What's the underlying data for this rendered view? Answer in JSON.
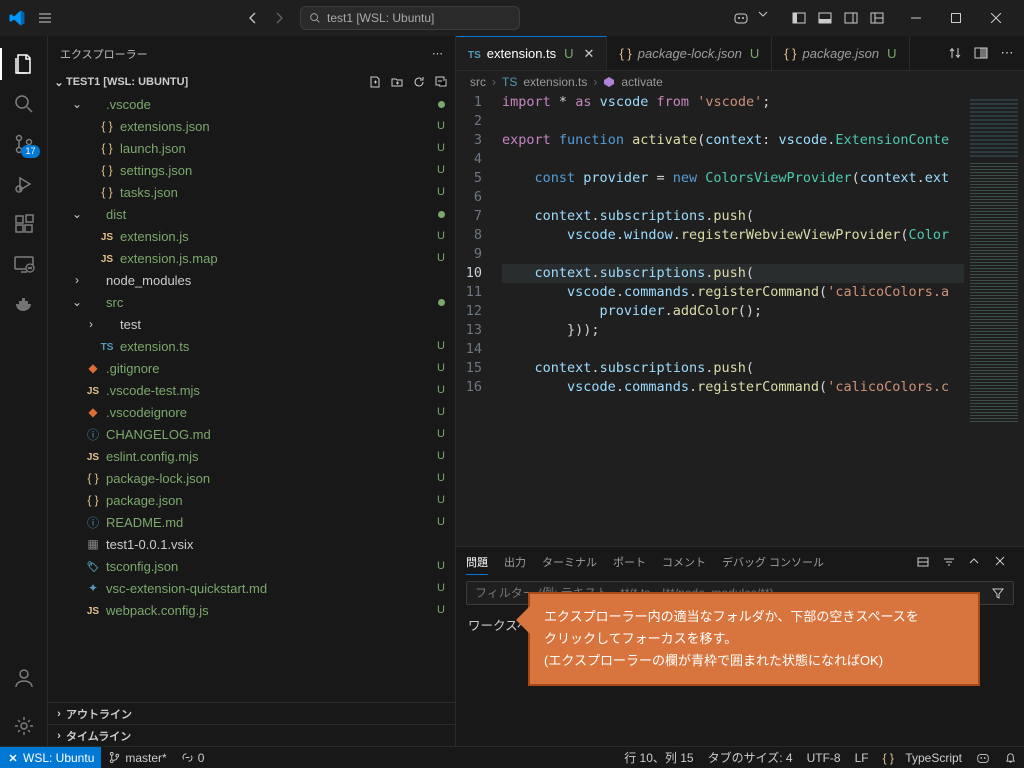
{
  "title_search": "test1 [WSL: Ubuntu]",
  "explorer": {
    "title": "エクスプローラー",
    "section": "TEST1 [WSL: UBUNTU]",
    "outline": "アウトライン",
    "timeline": "タイムライン"
  },
  "badge_scm": "17",
  "tree": [
    {
      "depth": 1,
      "kind": "folder",
      "open": true,
      "label": ".vscode",
      "decor": "dot"
    },
    {
      "depth": 2,
      "kind": "json",
      "label": "extensions.json",
      "decor": "U"
    },
    {
      "depth": 2,
      "kind": "json",
      "label": "launch.json",
      "decor": "U"
    },
    {
      "depth": 2,
      "kind": "json",
      "label": "settings.json",
      "decor": "U"
    },
    {
      "depth": 2,
      "kind": "json",
      "label": "tasks.json",
      "decor": "U"
    },
    {
      "depth": 1,
      "kind": "folder",
      "open": true,
      "label": "dist",
      "decor": "dot"
    },
    {
      "depth": 2,
      "kind": "js",
      "label": "extension.js",
      "decor": "U"
    },
    {
      "depth": 2,
      "kind": "js",
      "label": "extension.js.map",
      "decor": "U"
    },
    {
      "depth": 1,
      "kind": "folder",
      "open": false,
      "label": "node_modules",
      "decor": ""
    },
    {
      "depth": 1,
      "kind": "folder",
      "open": true,
      "label": "src",
      "decor": "dot"
    },
    {
      "depth": 2,
      "kind": "folder",
      "open": false,
      "label": "test",
      "decor": ""
    },
    {
      "depth": 2,
      "kind": "ts",
      "label": "extension.ts",
      "decor": "U"
    },
    {
      "depth": 1,
      "kind": "git",
      "label": ".gitignore",
      "decor": "U"
    },
    {
      "depth": 1,
      "kind": "js",
      "label": ".vscode-test.mjs",
      "decor": "U"
    },
    {
      "depth": 1,
      "kind": "git",
      "label": ".vscodeignore",
      "decor": "U"
    },
    {
      "depth": 1,
      "kind": "info",
      "label": "CHANGELOG.md",
      "decor": "U"
    },
    {
      "depth": 1,
      "kind": "js",
      "label": "eslint.config.mjs",
      "decor": "U"
    },
    {
      "depth": 1,
      "kind": "json",
      "label": "package-lock.json",
      "decor": "U"
    },
    {
      "depth": 1,
      "kind": "json",
      "label": "package.json",
      "decor": "U"
    },
    {
      "depth": 1,
      "kind": "info",
      "label": "README.md",
      "decor": "U"
    },
    {
      "depth": 1,
      "kind": "box",
      "label": "test1-0.0.1.vsix",
      "decor": ""
    },
    {
      "depth": 1,
      "kind": "tsc",
      "label": "tsconfig.json",
      "decor": "U"
    },
    {
      "depth": 1,
      "kind": "md",
      "label": "vsc-extension-quickstart.md",
      "decor": "U"
    },
    {
      "depth": 1,
      "kind": "js",
      "label": "webpack.config.js",
      "decor": "U"
    }
  ],
  "tabs": [
    {
      "icon": "ts",
      "label": "extension.ts",
      "mod": "U",
      "active": true,
      "italic": false,
      "close": true
    },
    {
      "icon": "json",
      "label": "package-lock.json",
      "mod": "U",
      "active": false,
      "italic": true,
      "close": false
    },
    {
      "icon": "json",
      "label": "package.json",
      "mod": "U",
      "active": false,
      "italic": true,
      "close": false
    }
  ],
  "breadcrumbs": [
    "src",
    "extension.ts",
    "activate"
  ],
  "code_lines": [
    "<span class='tok-pink'>import</span> <span class='tok-pun'>*</span> <span class='tok-pink'>as</span> <span class='tok-lblue'>vscode</span> <span class='tok-pink'>from</span> <span class='tok-str'>'vscode'</span><span class='tok-pun'>;</span>",
    "",
    "<span class='tok-pink'>export</span> <span class='tok-blue'>function</span> <span class='tok-fn'>activate</span><span class='tok-pun'>(</span><span class='tok-lblue'>context</span><span class='tok-pun'>:</span> <span class='tok-lblue'>vscode</span><span class='tok-pun'>.</span><span class='tok-type'>ExtensionConte</span>",
    "",
    "    <span class='tok-blue'>const</span> <span class='tok-lblue'>provider</span> <span class='tok-pun'>=</span> <span class='tok-blue'>new</span> <span class='tok-type'>ColorsViewProvider</span><span class='tok-pun'>(</span><span class='tok-lblue'>context</span><span class='tok-pun'>.</span><span class='tok-lblue'>ext</span>",
    "",
    "    <span class='tok-lblue'>context</span><span class='tok-pun'>.</span><span class='tok-lblue'>subscriptions</span><span class='tok-pun'>.</span><span class='tok-fn'>push</span><span class='tok-pun'>(</span>",
    "        <span class='tok-lblue'>vscode</span><span class='tok-pun'>.</span><span class='tok-lblue'>window</span><span class='tok-pun'>.</span><span class='tok-fn'>registerWebviewViewProvider</span><span class='tok-pun'>(</span><span class='tok-type'>Color</span>",
    "",
    "    <span class='tok-lblue'>context</span><span class='tok-pun'>.</span><span class='tok-lblue'>subscriptions</span><span class='tok-pun'>.</span><span class='tok-fn'>push</span><span class='tok-pun'>(</span>",
    "        <span class='tok-lblue'>vscode</span><span class='tok-pun'>.</span><span class='tok-lblue'>commands</span><span class='tok-pun'>.</span><span class='tok-fn'>registerCommand</span><span class='tok-pun'>(</span><span class='tok-str'>'calicoColors.a</span>",
    "            <span class='tok-lblue'>provider</span><span class='tok-pun'>.</span><span class='tok-fn'>addColor</span><span class='tok-pun'>();</span>",
    "        <span class='tok-pun'>}));</span>",
    "",
    "    <span class='tok-lblue'>context</span><span class='tok-pun'>.</span><span class='tok-lblue'>subscriptions</span><span class='tok-pun'>.</span><span class='tok-fn'>push</span><span class='tok-pun'>(</span>",
    "        <span class='tok-lblue'>vscode</span><span class='tok-pun'>.</span><span class='tok-lblue'>commands</span><span class='tok-pun'>.</span><span class='tok-fn'>registerCommand</span><span class='tok-pun'>(</span><span class='tok-str'>'calicoColors.c</span>"
  ],
  "current_line": 10,
  "panel": {
    "tabs": [
      "問題",
      "出力",
      "ターミナル",
      "ポート",
      "コメント",
      "デバッグ コンソール"
    ],
    "active": 0,
    "filter_ph": "フィルター (例: テキスト、**/*.ts、!**/node_modules/**)",
    "msg": "ワークスペースで問題は検出されていません。"
  },
  "status": {
    "remote": "WSL: Ubuntu",
    "branch": "master*",
    "ports": "0",
    "cursor": "行 10、列 15",
    "tabsize": "タブのサイズ: 4",
    "encoding": "UTF-8",
    "eol": "LF",
    "lang": "TypeScript"
  },
  "callout": {
    "l1": "エクスプローラー内の適当なフォルダか、下部の空きスペースを",
    "l2": "クリックしてフォーカスを移す。",
    "l3": "(エクスプローラーの欄が青枠で囲まれた状態になればOK)"
  }
}
